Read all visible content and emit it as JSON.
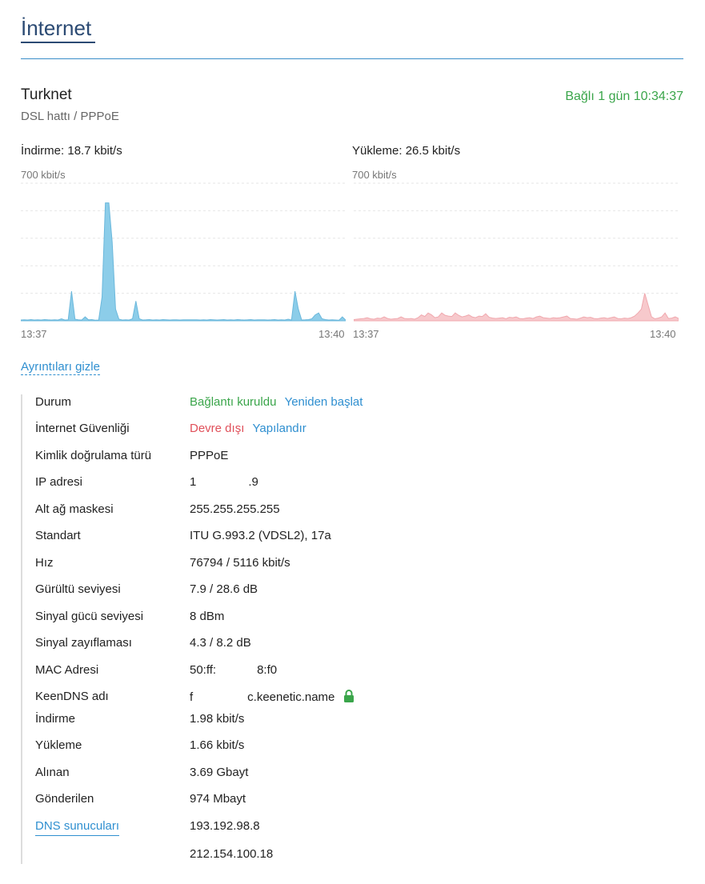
{
  "page": {
    "title": "İnternet"
  },
  "connection": {
    "provider": "Turknet",
    "line_type": "DSL hattı / PPPoE",
    "uptime": "Bağlı 1 gün 10:34:37"
  },
  "download": {
    "label": "İndirme: 18.7 kbit/s",
    "scale": "700 kbit/s",
    "time_start": "13:37",
    "time_end": "13:40",
    "color": "#8ccde9"
  },
  "upload": {
    "label": "Yükleme: 26.5 kbit/s",
    "scale": "700 kbit/s",
    "time_start": "13:37",
    "time_end": "13:40",
    "color": "#f7c9cc"
  },
  "chart_data": [
    {
      "type": "area",
      "series": [
        {
          "values": [
            4,
            5,
            4,
            6,
            4,
            5,
            4,
            6,
            5,
            4,
            5,
            4,
            10,
            4,
            5,
            150,
            8,
            5,
            4,
            20,
            5,
            6,
            3,
            4,
            120,
            600,
            600,
            400,
            60,
            8,
            4,
            5,
            4,
            10,
            100,
            10,
            4,
            5,
            6,
            4,
            5,
            4,
            6,
            5,
            4,
            5,
            5,
            4,
            5,
            5,
            5,
            5,
            5,
            4,
            5,
            4,
            6,
            5,
            4,
            5,
            6,
            4,
            5,
            4,
            6,
            5,
            4,
            5,
            6,
            4,
            5,
            5,
            5,
            4,
            5,
            6,
            4,
            5,
            4,
            8,
            4,
            150,
            60,
            4,
            5,
            6,
            10,
            30,
            40,
            10,
            6,
            4,
            5,
            4,
            3,
            20,
            4
          ]
        }
      ],
      "ylim": [
        0,
        700
      ]
    },
    {
      "type": "area",
      "series": [
        {
          "values": [
            6,
            8,
            10,
            12,
            16,
            10,
            8,
            14,
            12,
            20,
            12,
            8,
            10,
            12,
            20,
            12,
            10,
            12,
            8,
            16,
            30,
            22,
            40,
            30,
            16,
            20,
            40,
            28,
            24,
            22,
            40,
            28,
            20,
            24,
            30,
            20,
            16,
            24,
            22,
            36,
            18,
            14,
            12,
            14,
            16,
            10,
            18,
            16,
            20,
            12,
            10,
            14,
            16,
            12,
            20,
            24,
            16,
            14,
            12,
            16,
            14,
            16,
            20,
            24,
            12,
            10,
            8,
            14,
            20,
            16,
            18,
            12,
            10,
            14,
            16,
            12,
            16,
            20,
            12,
            10,
            14,
            12,
            16,
            24,
            40,
            60,
            140,
            80,
            20,
            10,
            14,
            20,
            40,
            12,
            14,
            20,
            12
          ]
        }
      ],
      "ylim": [
        0,
        700
      ]
    }
  ],
  "toggle": {
    "label": "Ayrıntıları gizle"
  },
  "details": {
    "status": {
      "label": "Durum",
      "value": "Bağlantı kuruldu",
      "action": "Yeniden başlat"
    },
    "security": {
      "label": "İnternet Güvenliği",
      "value": "Devre dışı",
      "action": "Yapılandır"
    },
    "auth": {
      "label": "Kimlik doğrulama türü",
      "value": "PPPoE"
    },
    "ip": {
      "label": "IP adresi",
      "value_start": "1",
      "value_end": ".9"
    },
    "mask": {
      "label": "Alt ağ maskesi",
      "value": "255.255.255.255"
    },
    "standard": {
      "label": "Standart",
      "value": "ITU G.993.2 (VDSL2), 17a"
    },
    "speed": {
      "label": "Hız",
      "value": "76794 / 5116 kbit/s"
    },
    "noise": {
      "label": "Gürültü seviyesi",
      "value": "7.9 / 28.6 dB"
    },
    "signal": {
      "label": "Sinyal gücü seviyesi",
      "value": "8 dBm"
    },
    "attenuation": {
      "label": "Sinyal zayıflaması",
      "value": "4.3 / 8.2 dB"
    },
    "mac": {
      "label": "MAC Adresi",
      "value_start": "50:ff:",
      "value_end": "8:f0"
    },
    "keendns": {
      "label": "KeenDNS adı",
      "value_start": "f",
      "value_end": "c.keenetic.name"
    },
    "dl": {
      "label": "İndirme",
      "value": "1.98 kbit/s"
    },
    "ul": {
      "label": "Yükleme",
      "value": "1.66 kbit/s"
    },
    "rx": {
      "label": "Alınan",
      "value": "3.69 Gbayt"
    },
    "tx": {
      "label": "Gönderilen",
      "value": "974 Mbayt"
    },
    "dns": {
      "label": "DNS sunucuları",
      "values": [
        "193.192.98.8",
        "212.154.100.18"
      ]
    }
  },
  "colors": {
    "accent": "#2f8fd0",
    "ok": "#3aa54a",
    "danger": "#e0505a",
    "lock": "#3aa54a"
  }
}
